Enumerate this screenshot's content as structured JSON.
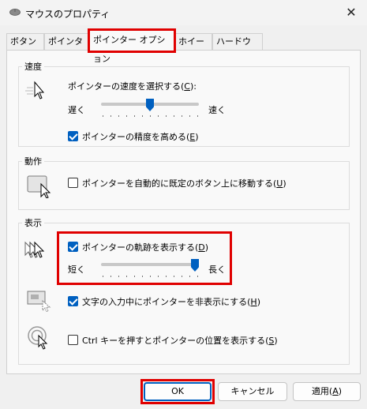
{
  "window": {
    "title": "マウスのプロパティ",
    "close": "✕"
  },
  "tabs": [
    {
      "label": "ボタン"
    },
    {
      "label": "ポインター"
    },
    {
      "label": "ポインター オプション"
    },
    {
      "label": "ホイール"
    },
    {
      "label": "ハードウェア"
    }
  ],
  "speed": {
    "title": "速度",
    "select_label": "ポインターの速度を選択する(",
    "select_key": "C",
    "select_suffix": "):",
    "slow": "遅く",
    "fast": "速く",
    "value_fraction": 0.5,
    "precision_label": "ポインターの精度を高める(",
    "precision_key": "E",
    "precision_suffix": ")",
    "precision_checked": true
  },
  "motion": {
    "title": "動作",
    "snap_label": "ポインターを自動的に既定のボタン上に移動する(",
    "snap_key": "U",
    "snap_suffix": ")",
    "snap_checked": false
  },
  "visibility": {
    "title": "表示",
    "trails_label": "ポインターの軌跡を表示する(",
    "trails_key": "D",
    "trails_suffix": ")",
    "trails_checked": true,
    "short": "短く",
    "long": "長く",
    "trails_fraction": 1.0,
    "hide_label": "文字の入力中にポインターを非表示にする(",
    "hide_key": "H",
    "hide_suffix": ")",
    "hide_checked": true,
    "ctrl_label": "Ctrl キーを押すとポインターの位置を表示する(",
    "ctrl_key": "S",
    "ctrl_suffix": ")",
    "ctrl_checked": false
  },
  "buttons": {
    "ok": "OK",
    "cancel": "キャンセル",
    "apply_label": "適用(",
    "apply_key": "A",
    "apply_suffix": ")"
  },
  "colors": {
    "accent": "#0060c0",
    "highlight": "#e00000"
  }
}
